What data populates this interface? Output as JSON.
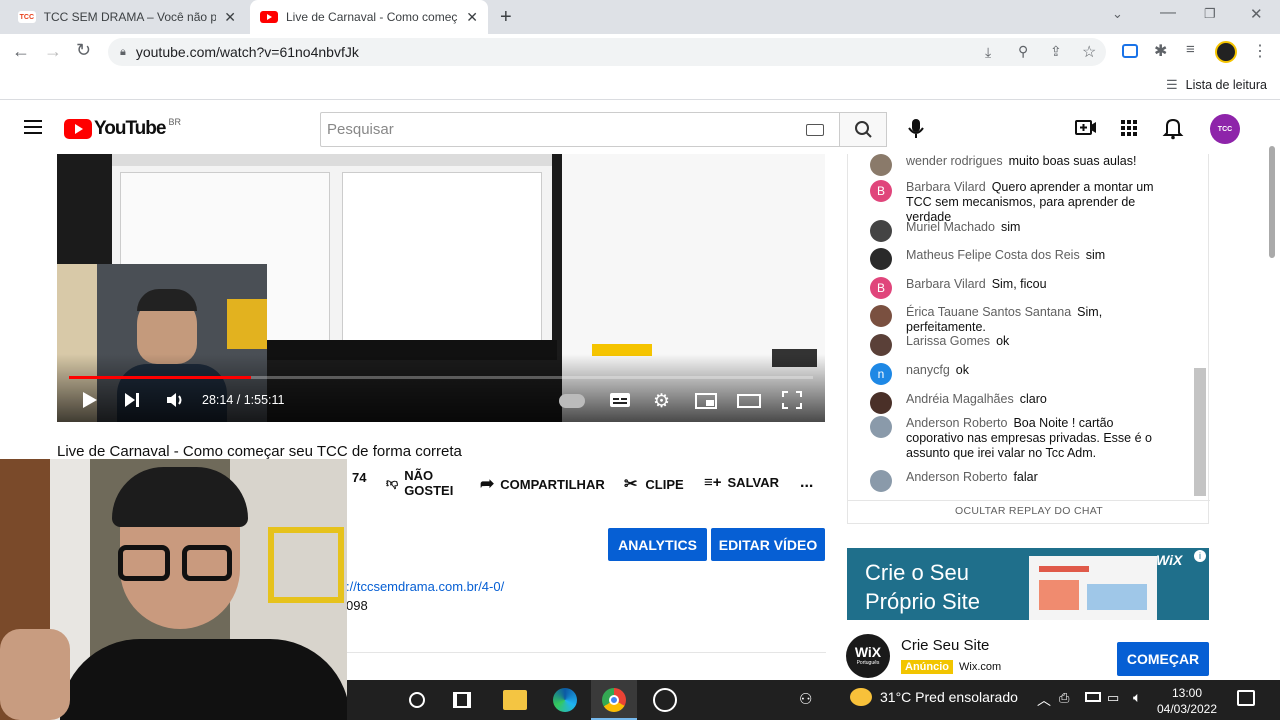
{
  "browser": {
    "tabs": [
      {
        "title": "TCC SEM DRAMA – Você não pre",
        "favicon": "tcc-logo",
        "active": false
      },
      {
        "title": "Live de Carnaval - Como começ",
        "favicon": "youtube-logo",
        "active": true
      }
    ],
    "new_tab": "+",
    "url": "youtube.com/watch?v=61no4nbvfJk",
    "reading_list": "Lista de leitura"
  },
  "youtube": {
    "logo_text": "YouTube",
    "region": "BR",
    "search_placeholder": "Pesquisar",
    "avatar_text": "TCC"
  },
  "video": {
    "time": "28:14 / 1:55:11",
    "progress": 0.245,
    "title": "Live de Carnaval - Como começar seu TCC de forma correta"
  },
  "actions": {
    "likes": "74",
    "dislike": "NÃO GOSTEI",
    "share": "COMPARTILHAR",
    "clip": "CLIPE",
    "save": "SALVAR",
    "more": "..."
  },
  "studio": {
    "analytics": "ANALYTICS",
    "edit": "EDITAR VÍDEO"
  },
  "description": {
    "link": "://tccsemdrama.com.br/4-0/",
    "number": "098"
  },
  "chat": {
    "messages": [
      {
        "author": "wender rodrigues",
        "text": "muito boas suas aulas!",
        "avatar": "photo",
        "color": "#8a7a6a"
      },
      {
        "author": "Barbara Vilard",
        "text": "Quero aprender a montar um TCC sem mecanismos, para aprender de verdade",
        "avatar": "B",
        "color": "#e0457b"
      },
      {
        "author": "Muriel Machado",
        "text": "sim",
        "avatar": "photo",
        "color": "#444444"
      },
      {
        "author": "Matheus Felipe Costa dos Reis",
        "text": "sim",
        "avatar": "photo",
        "color": "#2a2a2a"
      },
      {
        "author": "Barbara Vilard",
        "text": "Sim, ficou",
        "avatar": "B",
        "color": "#e0457b"
      },
      {
        "author": "Érica Tauane Santos Santana",
        "text": "Sim, perfeitamente.",
        "avatar": "photo",
        "color": "#7a5040"
      },
      {
        "author": "Larissa Gomes",
        "text": "ok",
        "avatar": "photo",
        "color": "#5a4038"
      },
      {
        "author": "nanycfg",
        "text": "ok",
        "avatar": "n",
        "color": "#1e88e5"
      },
      {
        "author": "Andréia Magalhães",
        "text": "claro",
        "avatar": "photo",
        "color": "#4a3028"
      },
      {
        "author": "Anderson Roberto",
        "text": "Boa Noite ! cartão coporativo nas empresas privadas. Esse é o assunto que irei valar no Tcc Adm.",
        "avatar": "photo",
        "color": "#8a9aaa"
      },
      {
        "author": "Anderson Roberto",
        "text": "falar",
        "avatar": "photo",
        "color": "#8a9aaa"
      }
    ],
    "hide_replay": "OCULTAR REPLAY DO CHAT"
  },
  "ad": {
    "banner_line1": "Crie o Seu",
    "banner_line2": "Próprio Site",
    "banner_brand": "WiX",
    "logo_text": "WiX",
    "logo_sub": "Português",
    "title": "Crie Seu Site",
    "badge": "Anúncio",
    "domain": "Wix.com",
    "cta": "COMEÇAR"
  },
  "taskbar": {
    "weather": "31°C  Pred ensolarado",
    "time": "13:00",
    "date": "04/03/2022"
  },
  "colors": {
    "youtube_red": "#ff0000",
    "accent_blue": "#065fd4",
    "taskbar": "#202020",
    "wix_banner": "#1f6f8b"
  }
}
